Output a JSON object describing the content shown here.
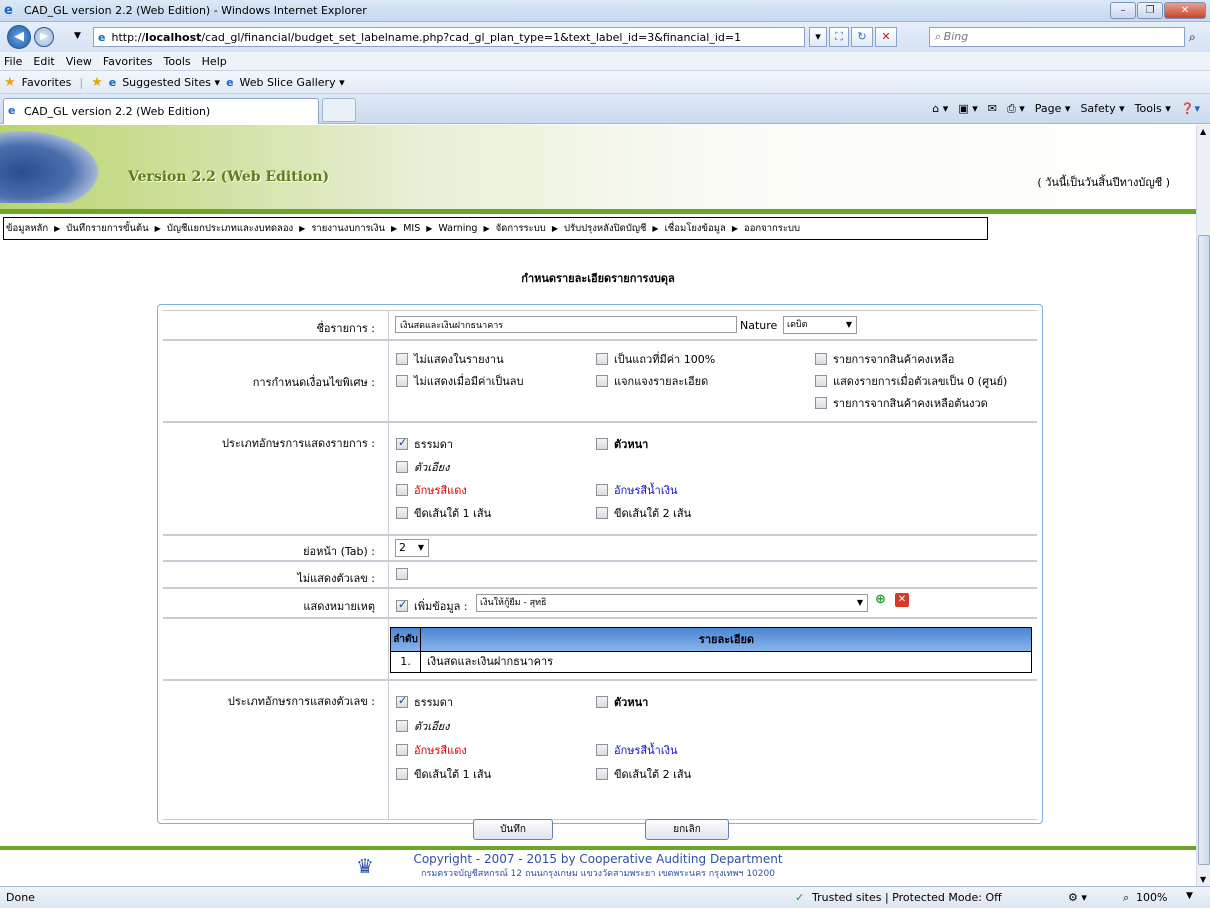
{
  "window": {
    "title": "CAD_GL version 2.2 (Web Edition) - Windows Internet Explorer"
  },
  "address": {
    "url_prefix": "http://",
    "url_host": "localhost",
    "url_path": "/cad_gl/financial/budget_set_labelname.php?cad_gl_plan_type=1&text_label_id=3&financial_id=1",
    "search_placeholder": "Bing"
  },
  "menu": [
    "File",
    "Edit",
    "View",
    "Favorites",
    "Tools",
    "Help"
  ],
  "favbar": {
    "favorites": "Favorites",
    "suggested": "Suggested Sites ▾",
    "webslice": "Web Slice Gallery ▾"
  },
  "tab": {
    "label": "CAD_GL version 2.2 (Web Edition)"
  },
  "commands": {
    "page": "Page ▾",
    "safety": "Safety ▾",
    "tools": "Tools ▾"
  },
  "header": {
    "version": "Version 2.2 (Web Edition)",
    "date_info": "( วันนี้เป็นวันสิ้นปีทางบัญชี )"
  },
  "nav": [
    "ข้อมูลหลัก",
    "บันทึกรายการขั้นต้น",
    "บัญชีแยกประเภทและงบทดลอง",
    "รายงานงบการเงิน",
    "MIS",
    "Warning",
    "จัดการระบบ",
    "ปรับปรุงหลังปิดบัญชี",
    "เชื่อมโยงข้อมูล",
    "ออกจากระบบ"
  ],
  "page_title": "กำหนดรายละเอียดรายการงบดุล",
  "form": {
    "item_name_label": "ชื่อรายการ :",
    "item_name_value": "เงินสดและเงินฝากธนาคาร",
    "nature_label": "Nature",
    "nature_value": "เดบิต",
    "special_label": "การกำหนดเงื่อนไขพิเศษ :",
    "special_opts": [
      "ไม่แสดงในรายงาน",
      "ไม่แสดงเมื่อมีค่าเป็นลบ",
      "เป็นแถวที่มีค่า 100%",
      "แจกแจงรายละเอียด",
      "รายการจากสินค้าคงเหลือ",
      "แสดงรายการเมื่อตัวเลขเป็น 0 (ศูนย์)",
      "รายการจากสินค้าคงเหลือต้นงวด"
    ],
    "font_label": "ประเภทอักษรการแสดงรายการ :",
    "font_opts": {
      "normal": "ธรรมดา",
      "bold": "ตัวหนา",
      "italic": "ตัวเอียง",
      "red": "อักษรสีแดง",
      "blue": "อักษรสีน้ำเงิน",
      "u1": "ขีดเส้นใต้ 1 เส้น",
      "u2": "ขีดเส้นใต้ 2 เส้น"
    },
    "indent_label": "ย่อหน้า (Tab) :",
    "indent_value": "2",
    "hide_num_label": "ไม่แสดงตัวเลข :",
    "note_label": "แสดงหมายเหตุ",
    "add_data_label": "เพิ่มข้อมูล :",
    "add_data_value": "เงินให้กู้ยืม - สุทธิ",
    "table": {
      "col_no": "ลำดับ",
      "col_detail": "รายละเอียด",
      "rows": [
        {
          "no": "1.",
          "detail": "เงินสดและเงินฝากธนาคาร"
        }
      ]
    },
    "num_font_label": "ประเภทอักษรการแสดงตัวเลข :",
    "save": "บันทึก",
    "cancel": "ยกเลิก"
  },
  "footer": {
    "copyright": "Copyright - 2007 - 2015 by Cooperative Auditing Department",
    "address": "กรมตรวจบัญชีสหกรณ์ 12 ถนนกรุงเกษม แขวงวัดสามพระยา เขตพระนคร กรุงเทพฯ 10200"
  },
  "status": {
    "done": "Done",
    "zone": "Trusted sites | Protected Mode: Off",
    "zoom": "100%"
  }
}
